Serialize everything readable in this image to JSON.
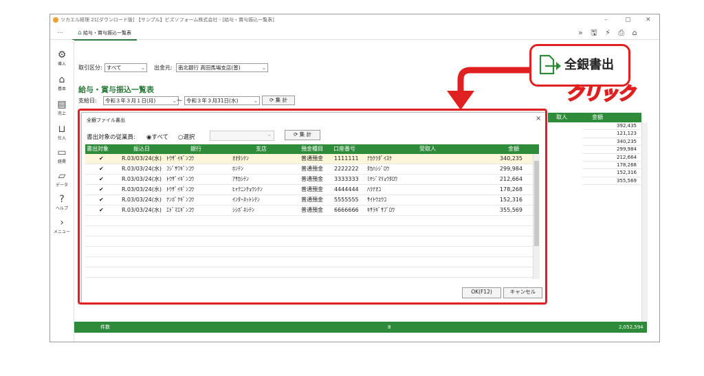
{
  "window": {
    "title": "ツカエル経理 21[ダウンロード版] 【サンプル】ビズソフォーム株式会社 - [給与・賞与振込一覧表]",
    "controls": [
      "–",
      "▢",
      "✕"
    ]
  },
  "tabbar": {
    "dots": "...",
    "tab_label": "給与・賞与振込一覧表",
    "icons": [
      "»",
      "🖫",
      "⚡",
      "⎙",
      "⌂"
    ]
  },
  "sidebar": {
    "items": [
      {
        "label": "導入",
        "icon": "gear-icon"
      },
      {
        "label": "基本",
        "icon": "home-icon"
      },
      {
        "label": "売上",
        "icon": "register-icon"
      },
      {
        "label": "仕入",
        "icon": "cart-icon"
      },
      {
        "label": "経費",
        "icon": "wallet-icon"
      },
      {
        "label": "データ",
        "icon": "folder-icon"
      },
      {
        "label": "ヘルプ",
        "icon": "help-icon"
      },
      {
        "label": "メニュー",
        "icon": "chevron-right-icon"
      }
    ]
  },
  "filters": {
    "kubun_label": "取引区分:",
    "kubun_value": "すべて",
    "source_label": "出金元:",
    "source_value": "南北銀行 高田馬場支店(普)",
    "date_label": "支給日:",
    "date_from": "令和３年３月１日(月)",
    "date_sep": "〜",
    "date_to": "令和３年３月31日(水)",
    "tally_label": "集 計"
  },
  "page_title": "給与・賞与振込一覧表",
  "background_table": {
    "headers": [
      "取人",
      "金額"
    ],
    "amounts": [
      "392,435",
      "121,123",
      "340,235",
      "299,984",
      "212,664",
      "178,268",
      "152,316",
      "355,569"
    ]
  },
  "footer": {
    "count_label": "件数",
    "count_value": "8",
    "total": "2,052,594"
  },
  "dialog": {
    "title": "全銀ファイル書出",
    "close": "×",
    "target_label": "書出対象の従業員:",
    "opt_all": "すべて",
    "opt_select": "選択",
    "tally_label": "集 計",
    "columns": [
      "書出対象",
      "振込日",
      "銀行",
      "支店",
      "預金種目",
      "口座番号",
      "受取人",
      "金額"
    ],
    "rows": [
      {
        "check": "✔",
        "date": "R.03/03/24(水)",
        "bank": "ﾄｳｻﾞｲｷﾞﾝｺｳ",
        "branch": "ｵｵﾀｼﾃﾝ",
        "type": "普通預金",
        "account": "1111111",
        "payee": "ﾅｶｸﾗﾀﾞｲｽｹ",
        "amount": "340,235"
      },
      {
        "check": "✔",
        "date": "R.03/03/24(水)",
        "bank": "ﾌｼﾞｻﾜｷﾞﾝｺｳ",
        "branch": "ﾎﾝﾃﾝ",
        "type": "普通預金",
        "account": "2222222",
        "payee": "ﾀｶﾊｼｼﾞﾛｳ",
        "amount": "299,984"
      },
      {
        "check": "✔",
        "date": "R.03/03/24(水)",
        "bank": "ﾄｳｻﾞｲｷﾞﾝｺｳ",
        "branch": "ｱｻｶｼﾃﾝ",
        "type": "普通預金",
        "account": "3333333",
        "payee": "ﾐﾔｼﾞﾏﾘｮｳﾀﾛｳ",
        "amount": "212,664"
      },
      {
        "check": "✔",
        "date": "R.03/03/24(水)",
        "bank": "ﾄｳｻﾞｲｷﾞﾝｺｳ",
        "branch": "ﾋｬｸﾆﾝﾁｮｳｼﾃﾝ",
        "type": "普通預金",
        "account": "4444444",
        "payee": "ﾊﾗﾅｵｺ",
        "amount": "178,268"
      },
      {
        "check": "✔",
        "date": "R.03/03/24(水)",
        "bank": "ﾅﾝﾎﾞｸｷﾞﾝｺｳ",
        "branch": "ｲﾝﾀｰﾈｯﾄｼﾃﾝ",
        "type": "普通預金",
        "account": "5555555",
        "payee": "ｻｲﾄｳﾕｳｺ",
        "amount": "152,316"
      },
      {
        "check": "✔",
        "date": "R.03/03/24(水)",
        "bank": "ｴﾄﾞﾏｴｷﾞﾝｺｳ",
        "branch": "ｼｼﾎﾞﾈｼﾃﾝ",
        "type": "普通預金",
        "account": "6666666",
        "payee": "ｷｻﾗｷﾞｻﾌﾞﾛｳ",
        "amount": "355,569"
      }
    ],
    "ok_label": "OK(F12)",
    "cancel_label": "キャンセル"
  },
  "callout": {
    "button_label": "全銀書出",
    "click_text": "クリック"
  },
  "colors": {
    "accent_green": "#2e8b3a",
    "highlight_red": "#e02020",
    "selected_row": "#fbf6da"
  }
}
